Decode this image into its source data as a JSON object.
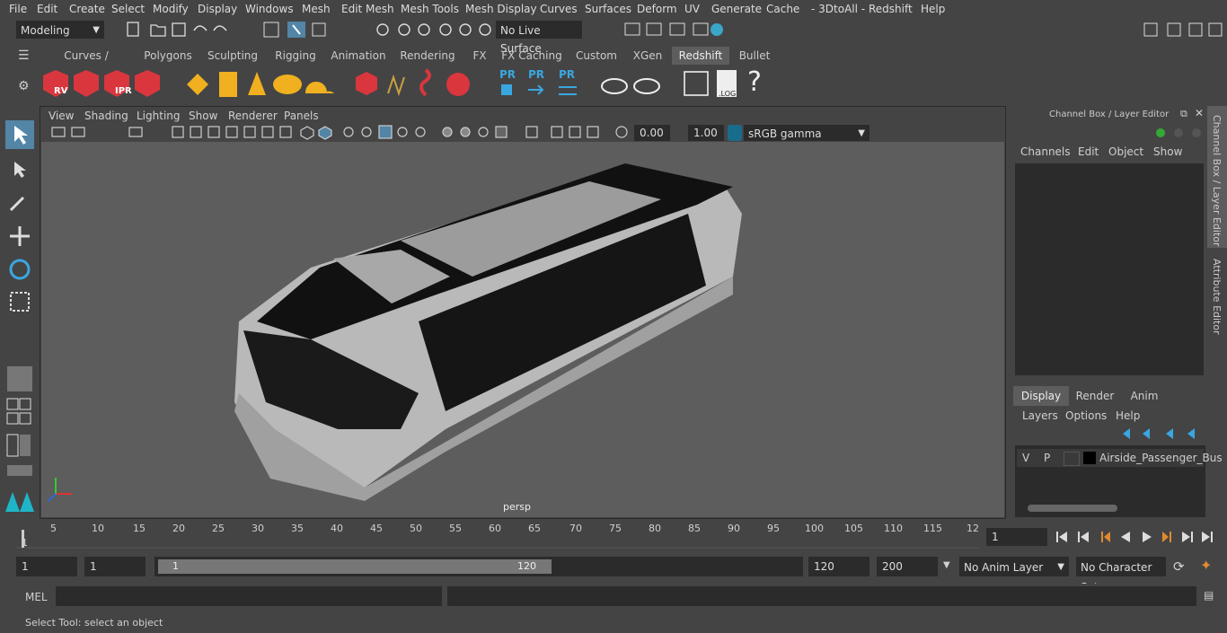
{
  "menu": [
    "File",
    "Edit",
    "Create",
    "Select",
    "Modify",
    "Display",
    "Windows",
    "Mesh",
    "Edit Mesh",
    "Mesh Tools",
    "Mesh Display",
    "Curves",
    "Surfaces",
    "Deform",
    "UV",
    "Generate",
    "Cache",
    "- 3DtoAll -",
    "Redshift",
    "Help"
  ],
  "toolbar": {
    "mode": "Modeling",
    "live_surface": "No Live Surface"
  },
  "shelf_tabs": [
    "Curves / Surfaces",
    "Polygons",
    "Sculpting",
    "Rigging",
    "Animation",
    "Rendering",
    "FX",
    "FX Caching",
    "Custom",
    "XGen",
    "Redshift",
    "Bullet"
  ],
  "shelf_active": "Redshift",
  "shelf_labels": {
    "rv": "RV",
    "ipr": "IPR",
    "pr": "PR",
    "log": ".LOG",
    "help": "?"
  },
  "viewport": {
    "menu": [
      "View",
      "Shading",
      "Lighting",
      "Show",
      "Renderer",
      "Panels"
    ],
    "exposure": "0.00",
    "gamma": "1.00",
    "colorspace": "sRGB gamma",
    "camera": "persp"
  },
  "channel_box": {
    "title": "Channel Box / Layer Editor",
    "menu": [
      "Channels",
      "Edit",
      "Object",
      "Show"
    ],
    "side_tabs": [
      "Channel Box / Layer Editor",
      "Attribute Editor"
    ]
  },
  "layer_editor": {
    "tabs": [
      "Display",
      "Render",
      "Anim"
    ],
    "active_tab": "Display",
    "menu": [
      "Layers",
      "Options",
      "Help"
    ],
    "layer": {
      "v": "V",
      "p": "P",
      "name": "Airside_Passenger_Bus"
    }
  },
  "timeline": {
    "ticks": [
      "5",
      "10",
      "15",
      "20",
      "25",
      "30",
      "35",
      "40",
      "45",
      "50",
      "55",
      "60",
      "65",
      "70",
      "75",
      "80",
      "85",
      "90",
      "95",
      "100",
      "105",
      "110",
      "115",
      "12"
    ],
    "current_start": "1",
    "current_frame": "1"
  },
  "range": {
    "start": "1",
    "start2": "1",
    "slider_start": "1",
    "slider_end": "120",
    "end": "120",
    "max": "200",
    "anim_layer": "No Anim Layer",
    "char_set": "No Character Set"
  },
  "mel": {
    "label": "MEL"
  },
  "status": {
    "text": "Select Tool: select an object"
  },
  "colors": {
    "accent": "#5285a6",
    "viewport_bg": "#5d5d5d",
    "panel": "#444444",
    "field": "#2b2b2b"
  }
}
